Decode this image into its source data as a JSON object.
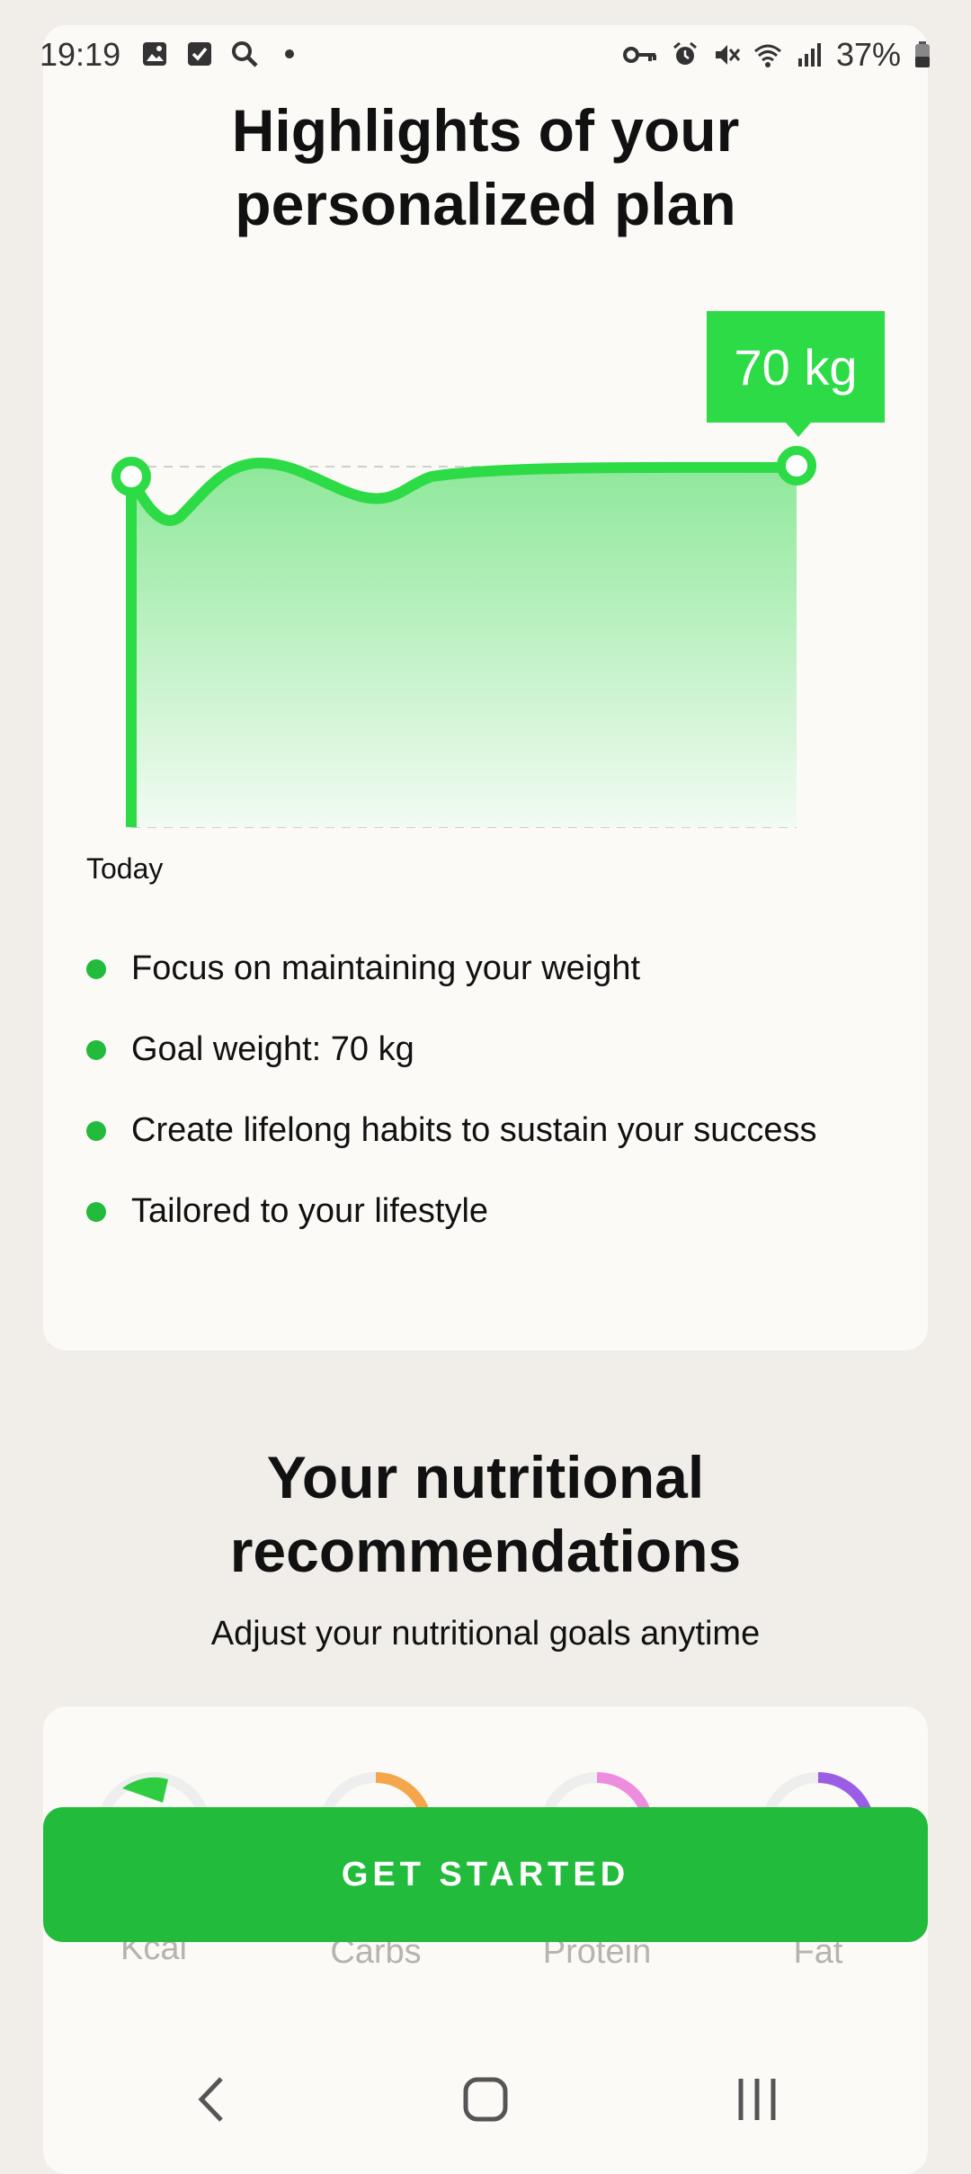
{
  "status": {
    "time": "19:19",
    "battery": "37%",
    "icons_left": [
      "image-icon",
      "check-square-icon",
      "search-icon",
      "dot-icon"
    ],
    "icons_right": [
      "key-icon",
      "alarm-icon",
      "mute-icon",
      "wifi-icon",
      "signal-icon",
      "battery-icon"
    ]
  },
  "plan": {
    "title_line1": "Highlights of your",
    "title_line2": "personalized plan",
    "goal_tag": "70 kg",
    "today_label": "Today",
    "bullets": [
      "Focus on maintaining your weight",
      "Goal weight: 70 kg",
      "Create lifelong habits to sustain your success",
      "Tailored to your lifestyle"
    ]
  },
  "nutrition": {
    "title_line1": "Your nutritional",
    "title_line2": "recommendations",
    "subtitle": "Adjust your nutritional goals anytime",
    "macros": [
      {
        "label": "Kcal",
        "color": "#2ecc40"
      },
      {
        "label": "Carbs",
        "color": "#f5a64a"
      },
      {
        "label": "Protein",
        "color": "#ee8de0"
      },
      {
        "label": "Fat",
        "color": "#9b5de5"
      }
    ]
  },
  "cta": {
    "label": "GET STARTED"
  },
  "colors": {
    "accent": "#22bb3c",
    "chart_line": "#2cdb46"
  }
}
